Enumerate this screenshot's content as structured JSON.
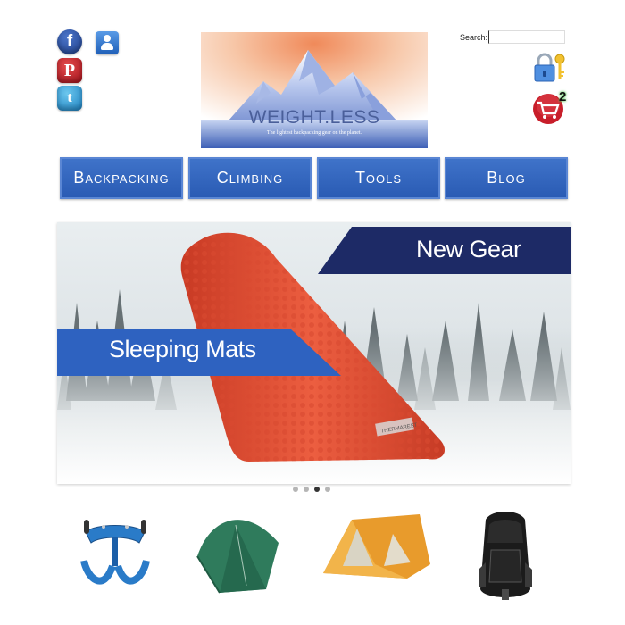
{
  "social": {
    "facebook_icon": "facebook-icon",
    "facebook_glyph": "f",
    "pinterest_icon": "pinterest-icon",
    "pinterest_glyph": "P",
    "twitter_icon": "twitter-icon",
    "twitter_glyph": "t",
    "contact_icon": "contact-icon"
  },
  "logo": {
    "title": "WEIGHT.LESS",
    "subtitle": "The lightest backpacking gear on the planet."
  },
  "search": {
    "label": "Search:",
    "value": ""
  },
  "account": {
    "lock_icon": "lock-key-icon",
    "cart_icon": "shopping-cart-icon",
    "cart_count": "2"
  },
  "nav": {
    "items": [
      {
        "label": "Backpacking"
      },
      {
        "label": "Climbing"
      },
      {
        "label": "Tools"
      },
      {
        "label": "Blog"
      }
    ]
  },
  "banner": {
    "label_top": "New Gear",
    "label_main": "Sleeping Mats",
    "mat_brand": "THERMAREST",
    "slide_count": 4,
    "active_slide": 3
  },
  "products": [
    {
      "icon": "climbing-harness-icon"
    },
    {
      "icon": "green-tent-icon"
    },
    {
      "icon": "orange-tent-icon"
    },
    {
      "icon": "backpack-icon"
    }
  ],
  "colors": {
    "nav_blue": "#2f62bb",
    "banner_navy": "#1d2a66",
    "banner_blue": "#2e62c0",
    "mat_orange": "#e3533a"
  }
}
